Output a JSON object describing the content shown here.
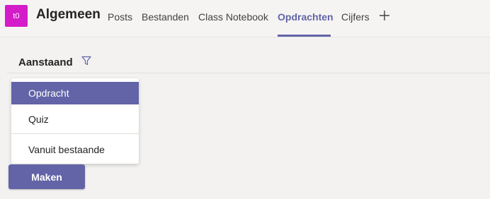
{
  "header": {
    "avatar_text": "t0",
    "team_name": "Algemeen",
    "tabs": [
      {
        "label": "Posts"
      },
      {
        "label": "Bestanden"
      },
      {
        "label": "Class Notebook"
      },
      {
        "label": "Opdrachten",
        "active": true
      },
      {
        "label": "Cijfers"
      }
    ],
    "add_tab_icon": "plus-icon"
  },
  "filter": {
    "label": "Aanstaand",
    "icon": "filter-icon"
  },
  "menu": {
    "items": [
      {
        "label": "Opdracht",
        "selected": true
      },
      {
        "label": "Quiz"
      },
      {
        "label": "Vanuit bestaande"
      }
    ]
  },
  "create_button": {
    "label": "Maken"
  },
  "colors": {
    "accent": "#6264a7",
    "avatar_bg": "#d41cc9",
    "background": "#f3f2f1"
  }
}
